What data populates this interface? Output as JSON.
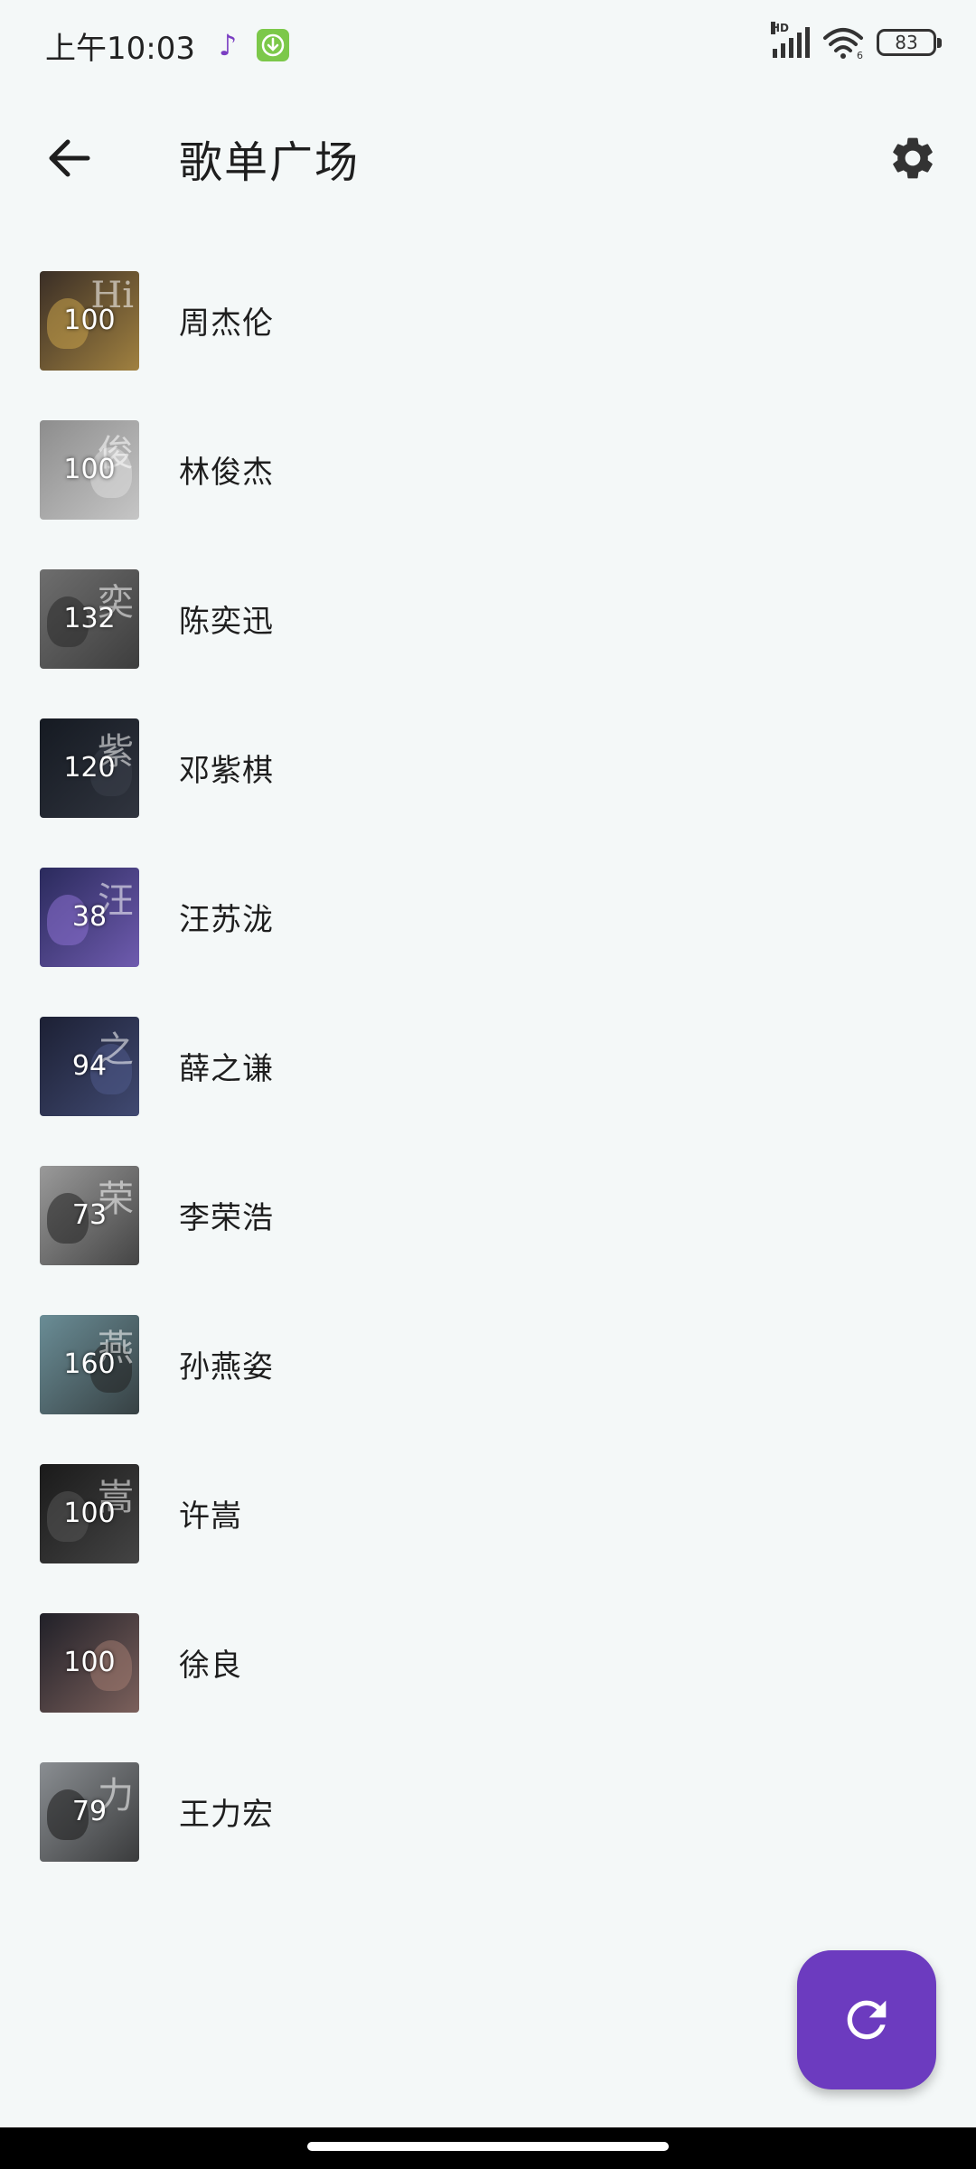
{
  "status_bar": {
    "time": "上午10:03",
    "battery": "83",
    "network_badge": "HD",
    "wifi_badge": "6"
  },
  "app_bar": {
    "title": "歌单广场",
    "back_icon": "arrow-left-icon",
    "settings_icon": "gear-icon"
  },
  "playlists": [
    {
      "name": "周杰伦",
      "count": "100",
      "thumb_color": "#3a2e26",
      "accent": "#c9a24a",
      "deco": "Hi"
    },
    {
      "name": "林俊杰",
      "count": "100",
      "thumb_color": "#8d8d8d",
      "accent": "#dcdcdc",
      "deco": "俊"
    },
    {
      "name": "陈奕迅",
      "count": "132",
      "thumb_color": "#6e6e6e",
      "accent": "#2a2a2a",
      "deco": "奕"
    },
    {
      "name": "邓紫棋",
      "count": "120",
      "thumb_color": "#151a22",
      "accent": "#3b3f4a",
      "deco": "紫"
    },
    {
      "name": "汪苏泷",
      "count": "38",
      "thumb_color": "#2a2a5c",
      "accent": "#8a6fd0",
      "deco": "汪"
    },
    {
      "name": "薛之谦",
      "count": "94",
      "thumb_color": "#1c2034",
      "accent": "#4f5a8a",
      "deco": "之"
    },
    {
      "name": "李荣浩",
      "count": "73",
      "thumb_color": "#9a9a9a",
      "accent": "#222222",
      "deco": "荣"
    },
    {
      "name": "孙燕姿",
      "count": "160",
      "thumb_color": "#6a8d96",
      "accent": "#222222",
      "deco": "燕"
    },
    {
      "name": "许嵩",
      "count": "100",
      "thumb_color": "#1a1a1a",
      "accent": "#555555",
      "deco": "嵩"
    },
    {
      "name": "徐良",
      "count": "100",
      "thumb_color": "#202028",
      "accent": "#a07a70",
      "deco": ""
    },
    {
      "name": "王力宏",
      "count": "79",
      "thumb_color": "#8a8e92",
      "accent": "#1a1a1a",
      "deco": "力"
    }
  ],
  "fab": {
    "icon": "refresh-icon",
    "color": "#6c3bbf"
  }
}
